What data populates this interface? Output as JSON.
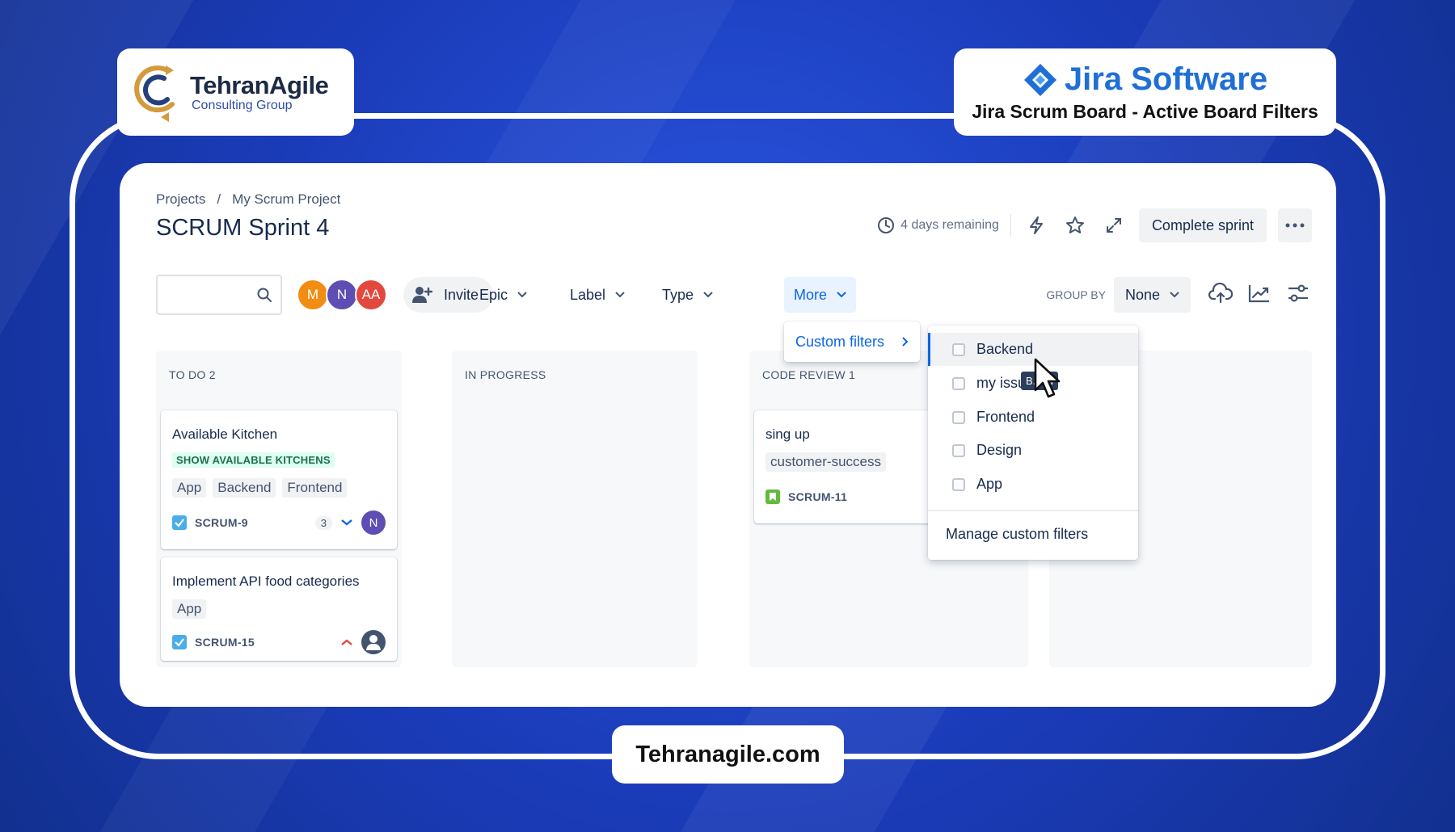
{
  "branding": {
    "company_name": "TehranAgile",
    "company_sub": "Consulting Group",
    "product_name": "Jira Software",
    "video_title": "Jira Scrum Board - Active Board Filters",
    "website": "Tehranagile.com"
  },
  "breadcrumb": {
    "root": "Projects",
    "separator": "/",
    "project": "My Scrum Project"
  },
  "sprint": {
    "title": "SCRUM Sprint 4",
    "time_remaining": "4 days remaining",
    "complete_label": "Complete sprint"
  },
  "toolbar": {
    "search_placeholder": "",
    "avatars": [
      {
        "initials": "M",
        "color": "#f18d13"
      },
      {
        "initials": "N",
        "color": "#5e4db2"
      },
      {
        "initials": "AA",
        "color": "#e2483d"
      }
    ],
    "invite_label": "Invite",
    "epic_label": "Epic",
    "label_label": "Label",
    "type_label": "Type",
    "more_label": "More",
    "group_by_label": "GROUP BY",
    "group_by_value": "None"
  },
  "columns": [
    {
      "title": "TO DO 2"
    },
    {
      "title": "IN PROGRESS"
    },
    {
      "title": "CODE REVIEW 1"
    },
    {
      "title": ""
    }
  ],
  "issues": [
    {
      "title": "Available Kitchen",
      "epic": "SHOW AVAILABLE KITCHENS",
      "labels": [
        "App",
        "Backend",
        "Frontend"
      ],
      "key": "SCRUM-9",
      "estimate": "3",
      "assignee": "N",
      "assignee_color": "#5e4db2",
      "priority": "low"
    },
    {
      "title": "Implement API food categories",
      "labels": [
        "App"
      ],
      "key": "SCRUM-15",
      "priority": "high"
    },
    {
      "title": "sing up",
      "labels": [
        "customer-success"
      ],
      "key": "SCRUM-11",
      "type": "story"
    }
  ],
  "more_menu": {
    "custom_filters_label": "Custom filters"
  },
  "custom_filters": {
    "items": [
      "Backend",
      "my issu",
      "Frontend",
      "Design",
      "App"
    ],
    "manage_label": "Manage custom filters",
    "tooltip": "B...nd"
  },
  "colors": {
    "accent": "#0c66e4",
    "background": "#1b3fc0",
    "epic_bg": "#dcfff1",
    "epic_text": "#216e4e"
  }
}
